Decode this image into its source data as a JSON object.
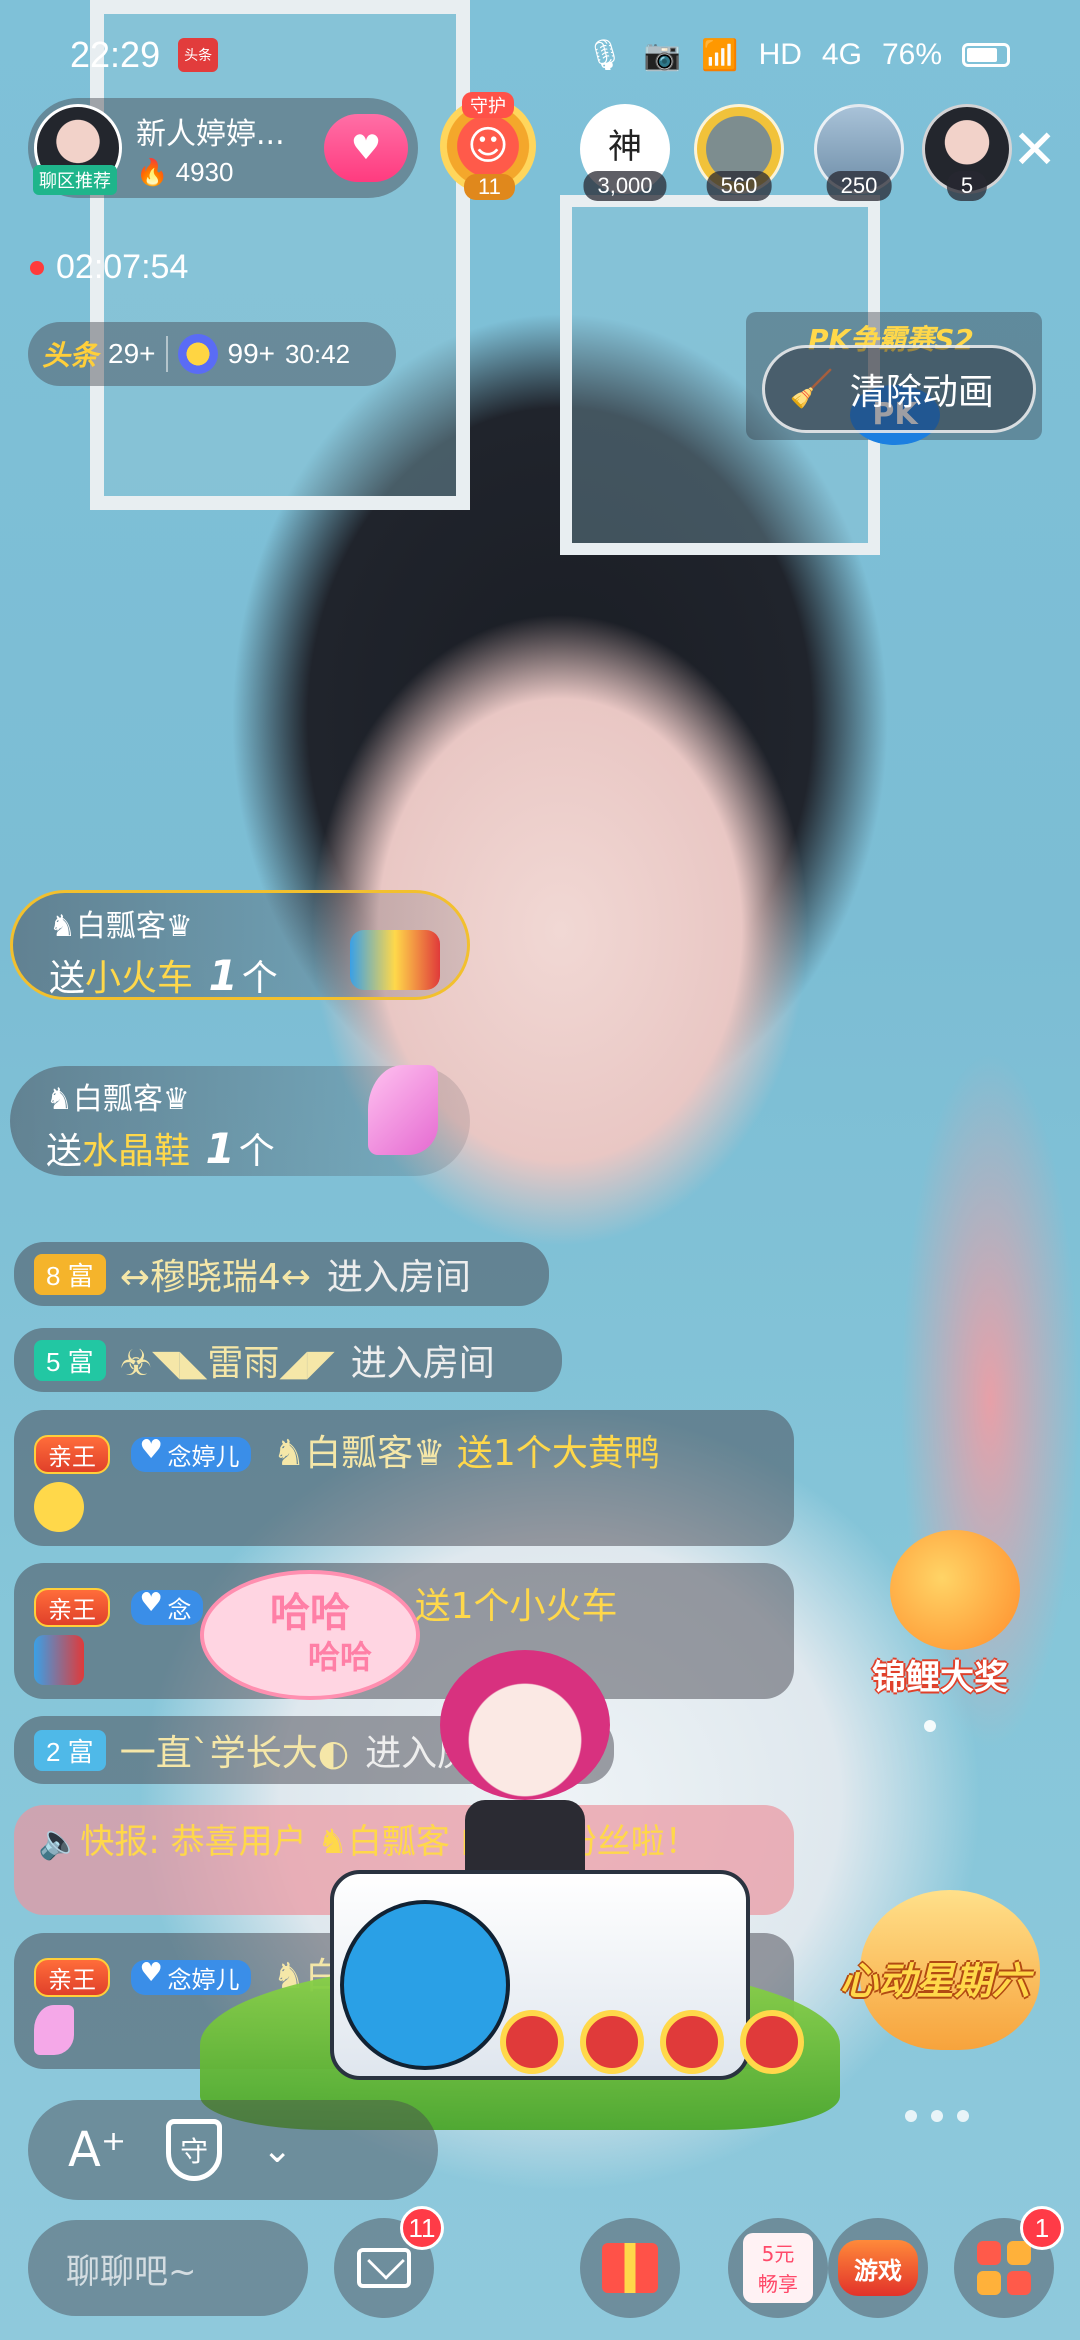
{
  "status_bar": {
    "time": "22:29",
    "app_badge": "头条",
    "network": "HD",
    "signal": "4G",
    "battery": "76%"
  },
  "host": {
    "name": "新人婷婷...",
    "tag": "聊区推荐",
    "heat": "4930"
  },
  "guard": {
    "label": "守护",
    "count": "11"
  },
  "ranking": [
    {
      "label": "神",
      "count": "3,000"
    },
    {
      "label": "",
      "count": "560"
    },
    {
      "label": "",
      "count": "250"
    },
    {
      "label": "",
      "count": "5"
    }
  ],
  "live_timer": "02:07:54",
  "stats": {
    "toutiao_label": "头条",
    "toutiao_rank": "29+",
    "star_rank": "99+",
    "star_time": "30:42"
  },
  "pk": {
    "title": "PK争霸赛S2",
    "clear_animation": "清除动画",
    "badge": "PK"
  },
  "gifts": [
    {
      "sender": "♞白瓢客♛",
      "prefix": "送",
      "gift": "小火车",
      "count": "1",
      "unit": "个"
    },
    {
      "sender": "♞白瓢客♛",
      "prefix": "送",
      "gift": "水晶鞋",
      "count": "1",
      "unit": "个"
    }
  ],
  "chat": {
    "enter1": {
      "level": "8 富",
      "nick": "↔穆晓瑞4↔",
      "text": "进入房间"
    },
    "enter2": {
      "level": "5 富",
      "nick": "☣◥◣雷雨◢◤",
      "text": "进入房间"
    },
    "msg1": {
      "badge1": "亲王",
      "badge2": "念婷儿",
      "nick": "♞白瓢客♛",
      "text": "送1个大黄鸭"
    },
    "msg2": {
      "badge1": "亲王",
      "badge2": "念",
      "nick": "客♛",
      "text": "送1个小火车"
    },
    "enter3": {
      "level": "2 富",
      "nick": "一直`学长大◐",
      "text": "进入房"
    },
    "broadcast": "🔈快报: 恭喜用户 ♞白瓢客 的皇冠粉丝啦！",
    "msg3": {
      "badge1": "亲王",
      "badge2": "念婷儿",
      "nick": "♞白"
    }
  },
  "animation": {
    "haha": "哈哈",
    "haha2": "哈哈"
  },
  "promos": {
    "koi": "锦鲤大奖",
    "heart": "心动星期六"
  },
  "bottom": {
    "font_icon": "A⁺",
    "guard_icon": "守",
    "chat_placeholder": "聊聊吧~",
    "mail_count": "11",
    "five_yuan_1": "5元",
    "five_yuan_2": "畅享",
    "game_label": "游戏",
    "more_count": "1"
  },
  "colors": {
    "accent_pink": "#ff3b7f",
    "gold": "#ffd84a",
    "chat_bg": "#46464f"
  }
}
